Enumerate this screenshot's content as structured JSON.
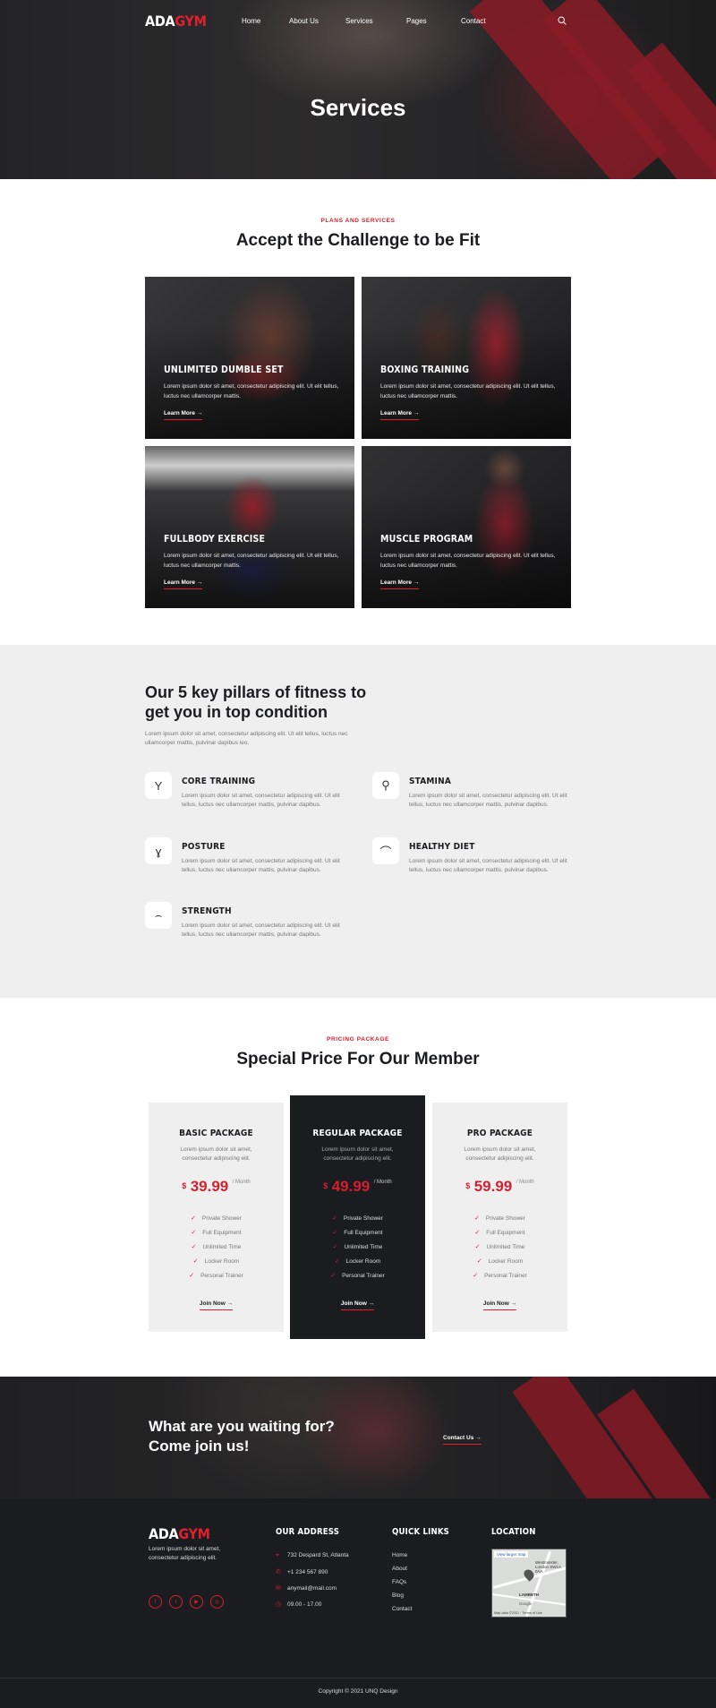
{
  "brand": {
    "logo_ada": "ADA",
    "logo_gym": "GYM",
    "accent": "#d41f2e"
  },
  "nav": {
    "items": [
      {
        "label": "Home"
      },
      {
        "label": "About Us"
      },
      {
        "label": "Services"
      },
      {
        "label": "Pages"
      },
      {
        "label": "Contact"
      }
    ],
    "search_icon": "search-icon"
  },
  "hero": {
    "title": "Services"
  },
  "services": {
    "eyebrow": "PLANS AND SERVICES",
    "title": "Accept the Challenge to be Fit",
    "cards": [
      {
        "title": "UNLIMITED DUMBLE SET",
        "desc": "Lorem ipsum dolor sit amet, consectetur adipiscing elit. Ut elit tellus, luctus nec ullamcorper mattis.",
        "link": "Learn More"
      },
      {
        "title": "BOXING TRAINING",
        "desc": "Lorem ipsum dolor sit amet, consectetur adipiscing elit. Ut elit tellus, luctus nec ullamcorper mattis.",
        "link": "Learn More"
      },
      {
        "title": "FULLBODY EXERCISE",
        "desc": "Lorem ipsum dolor sit amet, consectetur adipiscing elit. Ut elit tellus, luctus nec ullamcorper mattis.",
        "link": "Learn More"
      },
      {
        "title": "MUSCLE PROGRAM",
        "desc": "Lorem ipsum dolor sit amet, consectetur adipiscing elit. Ut elit tellus, luctus nec ullamcorper mattis.",
        "link": "Learn More"
      }
    ]
  },
  "pillars": {
    "title": "Our 5 key pillars of fitness to get you in top condition",
    "intro": "Lorem ipsum dolor sit amet, consectetur adipiscing elit. Ut elit tellus, luctus nec ullamcorper mattis, pulvinar dapibus leo.",
    "items": [
      {
        "title": "CORE TRAINING",
        "desc": "Lorem ipsum dolor sit amet, consectetur adipiscing elit. Ut elit tellus, luctus nec ullamcorper mattis, pulvinar dapibus.",
        "icon": "core-training-icon",
        "glyph": "Y"
      },
      {
        "title": "STAMINA",
        "desc": "Lorem ipsum dolor sit amet, consectetur adipiscing elit. Ut elit tellus, luctus nec ullamcorper mattis, pulvinar dapibus.",
        "icon": "stamina-icon",
        "glyph": "⚲"
      },
      {
        "title": "POSTURE",
        "desc": "Lorem ipsum dolor sit amet, consectetur adipiscing elit. Ut elit tellus, luctus nec ullamcorper mattis, pulvinar dapibus.",
        "icon": "posture-icon",
        "glyph": "ɣ"
      },
      {
        "title": "HEALTHY DIET",
        "desc": "Lorem ipsum dolor sit amet, consectetur adipiscing elit. Ut elit tellus, luctus nec ullamcorper mattis, pulvinar dapibus.",
        "icon": "healthy-diet-icon",
        "glyph": "⌒"
      },
      {
        "title": "STRENGTH",
        "desc": "Lorem ipsum dolor sit amet, consectetur adipiscing elit. Ut elit tellus, luctus nec ullamcorper mattis, pulvinar dapibus.",
        "icon": "strength-icon",
        "glyph": "⌢"
      }
    ]
  },
  "pricing": {
    "eyebrow": "PRICING PACKAGE",
    "title": "Special Price For Our Member",
    "plans": [
      {
        "name": "BASIC PACKAGE",
        "desc": "Lorem ipsum dolor sit amet, consectetur adipiscing elit.",
        "currency": "$",
        "amount": "39.99",
        "per": "/ Month",
        "features": [
          "Private Shower",
          "Full Equipment",
          "Unlimited Time",
          "Locker Room",
          "Personal Trainer"
        ],
        "cta": "Join Now"
      },
      {
        "name": "REGULAR PACKAGE",
        "desc": "Lorem ipsum dolor sit amet, consectetur adipiscing elit.",
        "currency": "$",
        "amount": "49.99",
        "per": "/ Month",
        "features": [
          "Private Shower",
          "Full Equipment",
          "Unlimited Time",
          "Locker Room",
          "Personal Trainer"
        ],
        "cta": "Join Now"
      },
      {
        "name": "PRO PACKAGE",
        "desc": "Lorem ipsum dolor sit amet, consectetur adipiscing elit.",
        "currency": "$",
        "amount": "59.99",
        "per": "/ Month",
        "features": [
          "Private Shower",
          "Full Equipment",
          "Unlimited Time",
          "Locker Room",
          "Personal Trainer"
        ],
        "cta": "Join Now"
      }
    ]
  },
  "cta": {
    "line1": "What are you waiting for?",
    "line2": "Come join us!",
    "button": "Contact Us"
  },
  "footer": {
    "desc": "Lorem ipsum dolor sit amet, consectetur adipiscing elit.",
    "social": [
      {
        "icon": "facebook-icon",
        "glyph": "f"
      },
      {
        "icon": "twitter-icon",
        "glyph": "t"
      },
      {
        "icon": "youtube-icon",
        "glyph": "▶"
      },
      {
        "icon": "instagram-icon",
        "glyph": "◎"
      }
    ],
    "address_title": "OUR ADDRESS",
    "address": [
      {
        "icon": "location-icon",
        "glyph": "⌖",
        "text": "732 Despard St, Atlanta"
      },
      {
        "icon": "phone-icon",
        "glyph": "✆",
        "text": "+1 234 567 890"
      },
      {
        "icon": "email-icon",
        "glyph": "✉",
        "text": "anymail@mail.com"
      },
      {
        "icon": "clock-icon",
        "glyph": "◷",
        "text": "09.00 - 17.00"
      }
    ],
    "links_title": "QUICK LINKS",
    "links": [
      "Home",
      "About",
      "FAQs",
      "Blog",
      "Contact"
    ],
    "location_title": "LOCATION",
    "map": {
      "view_larger": "View larger map",
      "place": "Westminster, London SW1A 0AA",
      "area": "LAMBETH",
      "google": "Google",
      "footer_note": "Map data ©2021 · Terms of Use"
    },
    "copyright": "Copyright © 2021 UNQ Design"
  }
}
